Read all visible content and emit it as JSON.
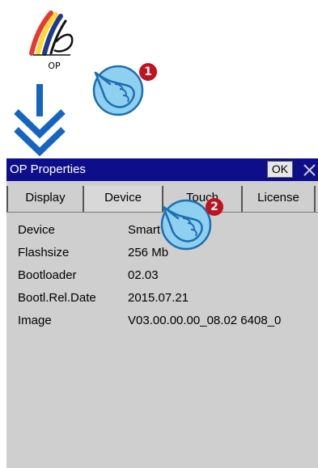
{
  "desktop_icon": {
    "label": "OP",
    "icon": "op-properties-icon"
  },
  "steps": [
    {
      "number": "1",
      "icon": "pointing-hand-icon"
    },
    {
      "number": "2",
      "icon": "pointing-hand-icon"
    }
  ],
  "window": {
    "title": "OP Properties",
    "ok_label": "OK",
    "close_icon": "close-icon",
    "title_bar_color": "#0e0e8a",
    "tabs": [
      {
        "label": "Display",
        "active": false
      },
      {
        "label": "Device",
        "active": true
      },
      {
        "label": "Touch",
        "active": false
      },
      {
        "label": "License",
        "active": false
      }
    ],
    "properties": [
      {
        "key": "Device",
        "value": "Smart Line V3"
      },
      {
        "key": "Flashsize",
        "value": "256 Mb"
      },
      {
        "key": "Bootloader",
        "value": "02.03"
      },
      {
        "key": "Bootl.Rel.Date",
        "value": "2015.07.21"
      },
      {
        "key": "Image",
        "value": "V03.00.00.00_08.02  6408_0"
      }
    ]
  },
  "colors": {
    "badge": "#c1121f",
    "arrow": "#1565c0",
    "hand": "#8fd0f0"
  }
}
